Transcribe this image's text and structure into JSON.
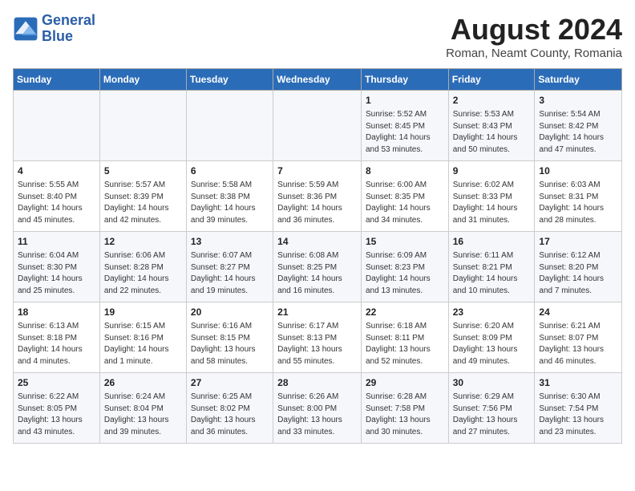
{
  "header": {
    "logo_line1": "General",
    "logo_line2": "Blue",
    "title": "August 2024",
    "subtitle": "Roman, Neamt County, Romania"
  },
  "days_of_week": [
    "Sunday",
    "Monday",
    "Tuesday",
    "Wednesday",
    "Thursday",
    "Friday",
    "Saturday"
  ],
  "weeks": [
    [
      {
        "day": "",
        "info": ""
      },
      {
        "day": "",
        "info": ""
      },
      {
        "day": "",
        "info": ""
      },
      {
        "day": "",
        "info": ""
      },
      {
        "day": "1",
        "info": "Sunrise: 5:52 AM\nSunset: 8:45 PM\nDaylight: 14 hours\nand 53 minutes."
      },
      {
        "day": "2",
        "info": "Sunrise: 5:53 AM\nSunset: 8:43 PM\nDaylight: 14 hours\nand 50 minutes."
      },
      {
        "day": "3",
        "info": "Sunrise: 5:54 AM\nSunset: 8:42 PM\nDaylight: 14 hours\nand 47 minutes."
      }
    ],
    [
      {
        "day": "4",
        "info": "Sunrise: 5:55 AM\nSunset: 8:40 PM\nDaylight: 14 hours\nand 45 minutes."
      },
      {
        "day": "5",
        "info": "Sunrise: 5:57 AM\nSunset: 8:39 PM\nDaylight: 14 hours\nand 42 minutes."
      },
      {
        "day": "6",
        "info": "Sunrise: 5:58 AM\nSunset: 8:38 PM\nDaylight: 14 hours\nand 39 minutes."
      },
      {
        "day": "7",
        "info": "Sunrise: 5:59 AM\nSunset: 8:36 PM\nDaylight: 14 hours\nand 36 minutes."
      },
      {
        "day": "8",
        "info": "Sunrise: 6:00 AM\nSunset: 8:35 PM\nDaylight: 14 hours\nand 34 minutes."
      },
      {
        "day": "9",
        "info": "Sunrise: 6:02 AM\nSunset: 8:33 PM\nDaylight: 14 hours\nand 31 minutes."
      },
      {
        "day": "10",
        "info": "Sunrise: 6:03 AM\nSunset: 8:31 PM\nDaylight: 14 hours\nand 28 minutes."
      }
    ],
    [
      {
        "day": "11",
        "info": "Sunrise: 6:04 AM\nSunset: 8:30 PM\nDaylight: 14 hours\nand 25 minutes."
      },
      {
        "day": "12",
        "info": "Sunrise: 6:06 AM\nSunset: 8:28 PM\nDaylight: 14 hours\nand 22 minutes."
      },
      {
        "day": "13",
        "info": "Sunrise: 6:07 AM\nSunset: 8:27 PM\nDaylight: 14 hours\nand 19 minutes."
      },
      {
        "day": "14",
        "info": "Sunrise: 6:08 AM\nSunset: 8:25 PM\nDaylight: 14 hours\nand 16 minutes."
      },
      {
        "day": "15",
        "info": "Sunrise: 6:09 AM\nSunset: 8:23 PM\nDaylight: 14 hours\nand 13 minutes."
      },
      {
        "day": "16",
        "info": "Sunrise: 6:11 AM\nSunset: 8:21 PM\nDaylight: 14 hours\nand 10 minutes."
      },
      {
        "day": "17",
        "info": "Sunrise: 6:12 AM\nSunset: 8:20 PM\nDaylight: 14 hours\nand 7 minutes."
      }
    ],
    [
      {
        "day": "18",
        "info": "Sunrise: 6:13 AM\nSunset: 8:18 PM\nDaylight: 14 hours\nand 4 minutes."
      },
      {
        "day": "19",
        "info": "Sunrise: 6:15 AM\nSunset: 8:16 PM\nDaylight: 14 hours\nand 1 minute."
      },
      {
        "day": "20",
        "info": "Sunrise: 6:16 AM\nSunset: 8:15 PM\nDaylight: 13 hours\nand 58 minutes."
      },
      {
        "day": "21",
        "info": "Sunrise: 6:17 AM\nSunset: 8:13 PM\nDaylight: 13 hours\nand 55 minutes."
      },
      {
        "day": "22",
        "info": "Sunrise: 6:18 AM\nSunset: 8:11 PM\nDaylight: 13 hours\nand 52 minutes."
      },
      {
        "day": "23",
        "info": "Sunrise: 6:20 AM\nSunset: 8:09 PM\nDaylight: 13 hours\nand 49 minutes."
      },
      {
        "day": "24",
        "info": "Sunrise: 6:21 AM\nSunset: 8:07 PM\nDaylight: 13 hours\nand 46 minutes."
      }
    ],
    [
      {
        "day": "25",
        "info": "Sunrise: 6:22 AM\nSunset: 8:05 PM\nDaylight: 13 hours\nand 43 minutes."
      },
      {
        "day": "26",
        "info": "Sunrise: 6:24 AM\nSunset: 8:04 PM\nDaylight: 13 hours\nand 39 minutes."
      },
      {
        "day": "27",
        "info": "Sunrise: 6:25 AM\nSunset: 8:02 PM\nDaylight: 13 hours\nand 36 minutes."
      },
      {
        "day": "28",
        "info": "Sunrise: 6:26 AM\nSunset: 8:00 PM\nDaylight: 13 hours\nand 33 minutes."
      },
      {
        "day": "29",
        "info": "Sunrise: 6:28 AM\nSunset: 7:58 PM\nDaylight: 13 hours\nand 30 minutes."
      },
      {
        "day": "30",
        "info": "Sunrise: 6:29 AM\nSunset: 7:56 PM\nDaylight: 13 hours\nand 27 minutes."
      },
      {
        "day": "31",
        "info": "Sunrise: 6:30 AM\nSunset: 7:54 PM\nDaylight: 13 hours\nand 23 minutes."
      }
    ]
  ]
}
